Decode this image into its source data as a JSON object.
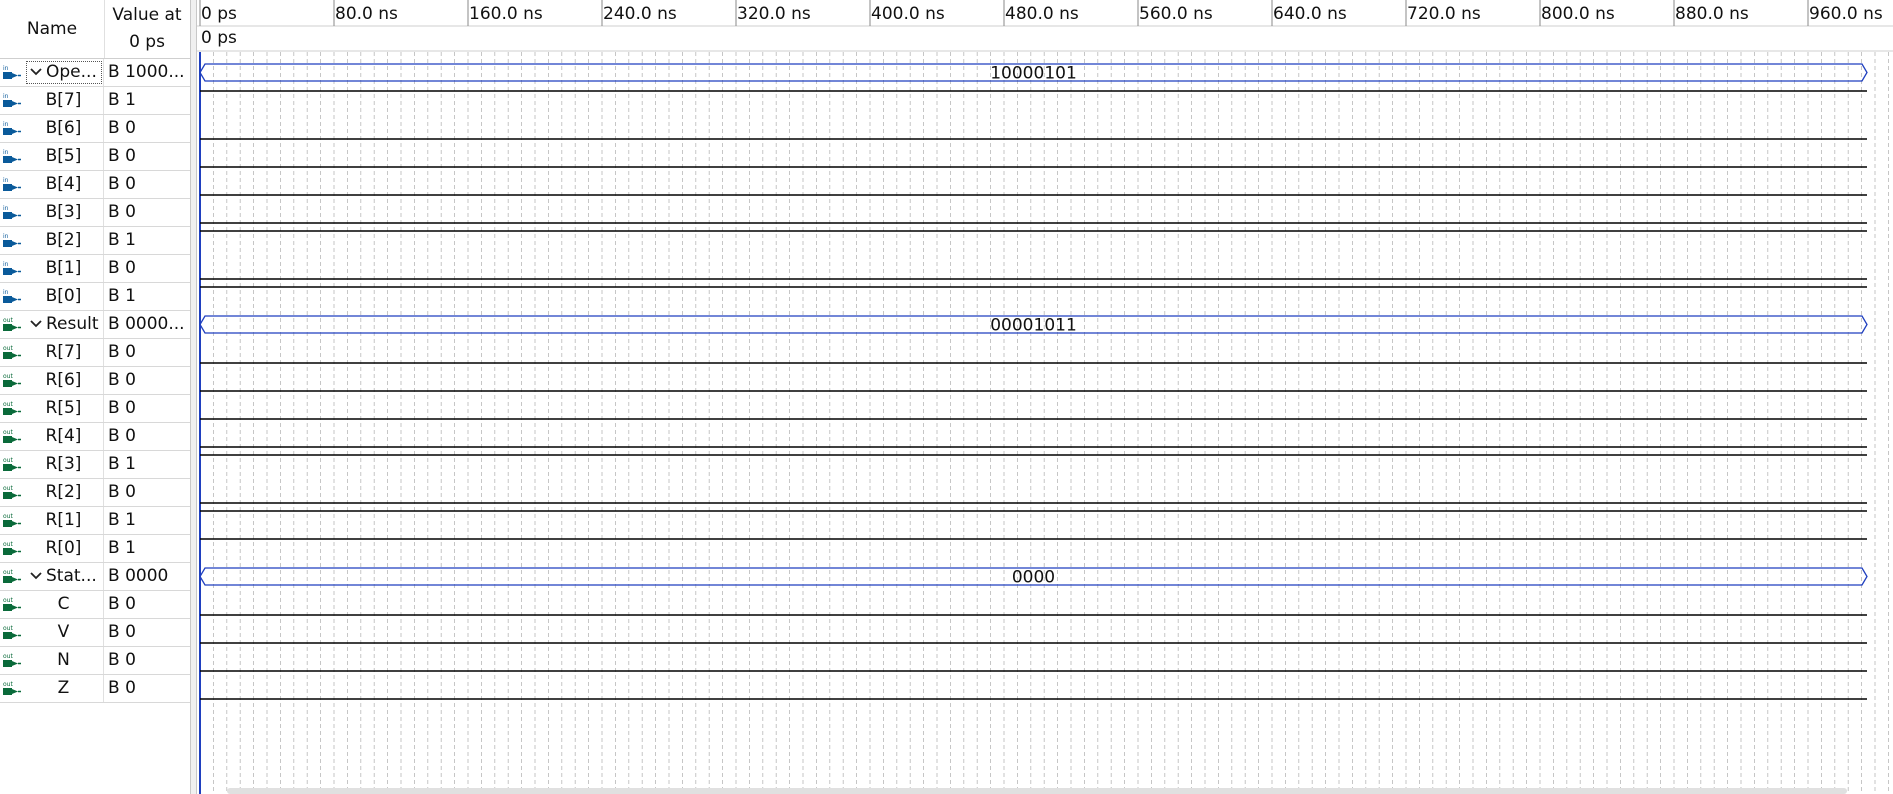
{
  "header": {
    "name_label": "Name",
    "value_label_line1": "Value at",
    "value_label_line2": "0 ps"
  },
  "timeline": {
    "ticks": [
      "0 ps",
      "80.0 ns",
      "160.0 ns",
      "240.0 ns",
      "320.0 ns",
      "400.0 ns",
      "480.0 ns",
      "560.0 ns",
      "640.0 ns",
      "720.0 ns",
      "800.0 ns",
      "880.0 ns",
      "960.0 ns"
    ],
    "cursor_label": "0 ps"
  },
  "signals": [
    {
      "kind": "group",
      "direction": "in",
      "name": "Ope...",
      "value": "B 1000...",
      "bus_value": "10000101"
    },
    {
      "kind": "bit",
      "direction": "in",
      "name": "B[7]",
      "value": "B 1",
      "level": 1
    },
    {
      "kind": "bit",
      "direction": "in",
      "name": "B[6]",
      "value": "B 0",
      "level": 0
    },
    {
      "kind": "bit",
      "direction": "in",
      "name": "B[5]",
      "value": "B 0",
      "level": 0
    },
    {
      "kind": "bit",
      "direction": "in",
      "name": "B[4]",
      "value": "B 0",
      "level": 0
    },
    {
      "kind": "bit",
      "direction": "in",
      "name": "B[3]",
      "value": "B 0",
      "level": 0
    },
    {
      "kind": "bit",
      "direction": "in",
      "name": "B[2]",
      "value": "B 1",
      "level": 1
    },
    {
      "kind": "bit",
      "direction": "in",
      "name": "B[1]",
      "value": "B 0",
      "level": 0
    },
    {
      "kind": "bit",
      "direction": "in",
      "name": "B[0]",
      "value": "B 1",
      "level": 1
    },
    {
      "kind": "group",
      "direction": "out",
      "name": "Result",
      "value": "B 0000...",
      "bus_value": "00001011"
    },
    {
      "kind": "bit",
      "direction": "out",
      "name": "R[7]",
      "value": "B 0",
      "level": 0
    },
    {
      "kind": "bit",
      "direction": "out",
      "name": "R[6]",
      "value": "B 0",
      "level": 0
    },
    {
      "kind": "bit",
      "direction": "out",
      "name": "R[5]",
      "value": "B 0",
      "level": 0
    },
    {
      "kind": "bit",
      "direction": "out",
      "name": "R[4]",
      "value": "B 0",
      "level": 0
    },
    {
      "kind": "bit",
      "direction": "out",
      "name": "R[3]",
      "value": "B 1",
      "level": 1
    },
    {
      "kind": "bit",
      "direction": "out",
      "name": "R[2]",
      "value": "B 0",
      "level": 0
    },
    {
      "kind": "bit",
      "direction": "out",
      "name": "R[1]",
      "value": "B 1",
      "level": 1
    },
    {
      "kind": "bit",
      "direction": "out",
      "name": "R[0]",
      "value": "B 1",
      "level": 1
    },
    {
      "kind": "group",
      "direction": "out",
      "name": "Stat...",
      "value": "B 0000",
      "bus_value": "0000"
    },
    {
      "kind": "bit",
      "direction": "out",
      "name": "C",
      "value": "B 0",
      "level": 0
    },
    {
      "kind": "bit",
      "direction": "out",
      "name": "V",
      "value": "B 0",
      "level": 0
    },
    {
      "kind": "bit",
      "direction": "out",
      "name": "N",
      "value": "B 0",
      "level": 0
    },
    {
      "kind": "bit",
      "direction": "out",
      "name": "Z",
      "value": "B 0",
      "level": 0
    }
  ],
  "colors": {
    "bus": "#1f3fbf",
    "wire": "#000000",
    "grid": "#b8b8b8",
    "cursor": "#1f3fbf",
    "icon_in": "#0a5a9a",
    "icon_out": "#0a6a3a"
  }
}
